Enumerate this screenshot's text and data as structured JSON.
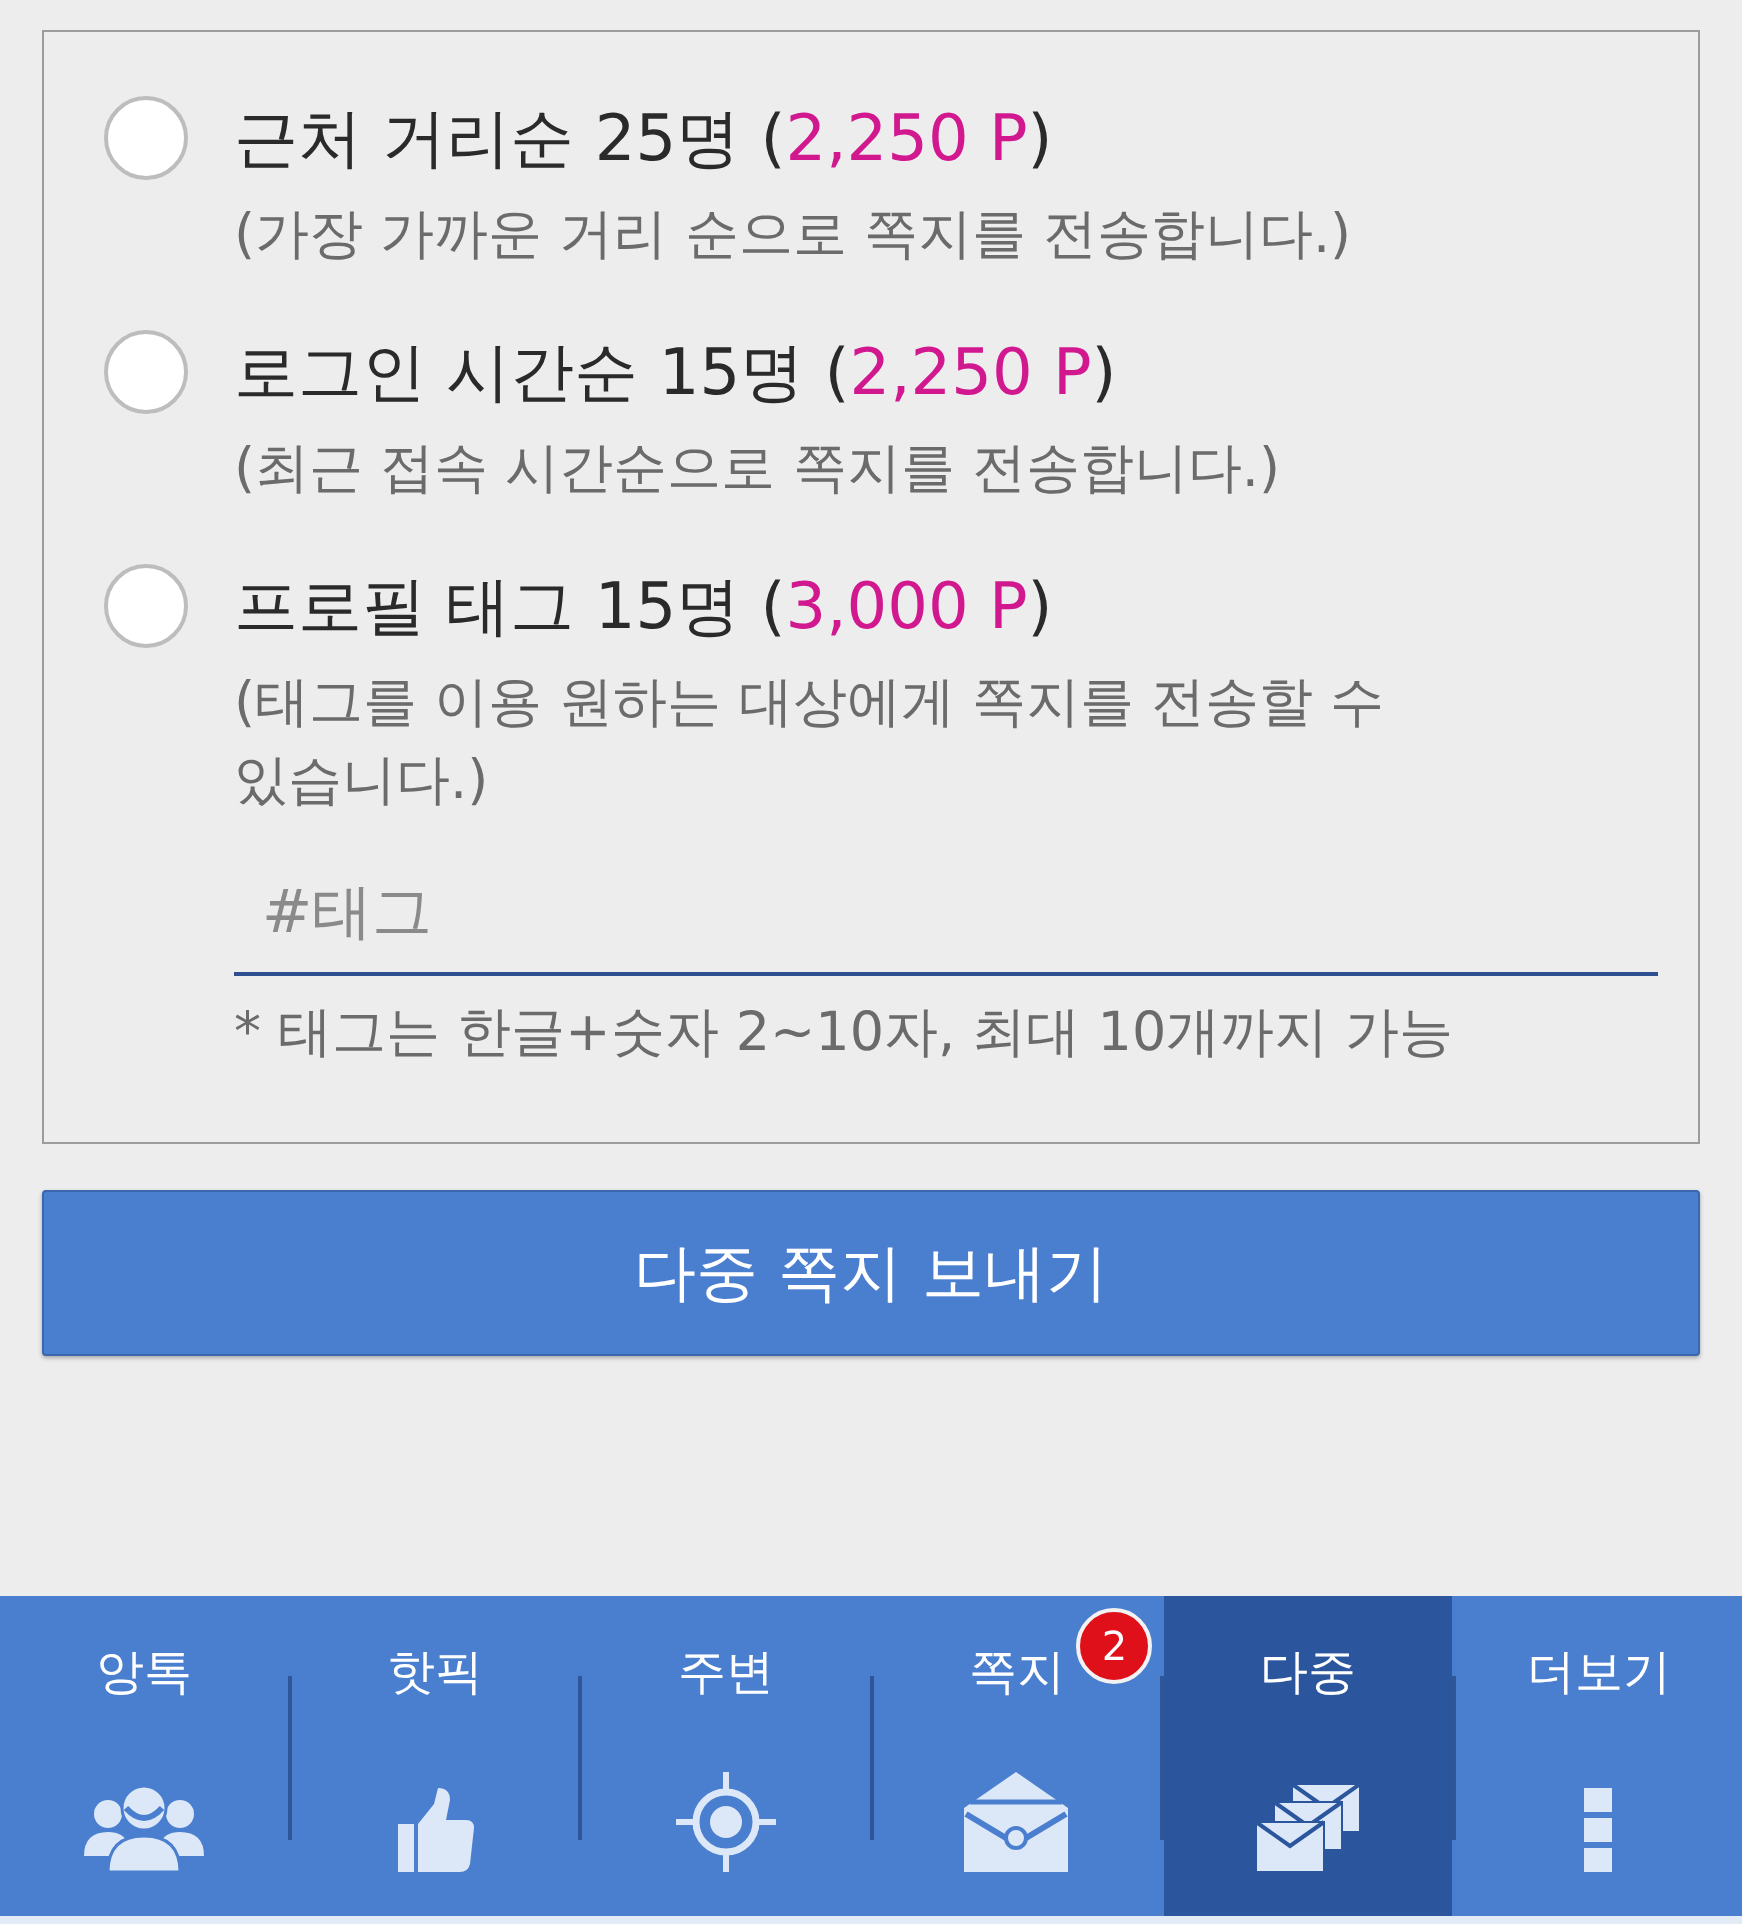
{
  "options": [
    {
      "kind": "plain",
      "selected": false,
      "label": "근처 거리순 25명 (",
      "price": "2,250 P",
      "label_end": ")",
      "description": "(가장 가까운 거리 순으로 쪽지를 전송합니다.)"
    },
    {
      "kind": "plain",
      "selected": false,
      "label": "로그인 시간순 15명 (",
      "price": "2,250 P",
      "label_end": ")",
      "description": "(최근 접속 시간순으로 쪽지를 전송합니다.)"
    },
    {
      "kind": "tag",
      "selected": false,
      "label": "프로필 태그 15명 (",
      "price": "3,000 P",
      "label_end": ")",
      "description": "(태그를 이용 원하는 대상에게 쪽지를 전송할 수 있습니다.)",
      "tag_field": {
        "placeholder": "#태그"
      },
      "hint": "* 태그는 한글+숫자 2~10자, 최대 10개까지 가능"
    }
  ],
  "send_button": "다중 쪽지 보내기",
  "bottom_nav": [
    {
      "label": "앙톡",
      "selected": false
    },
    {
      "label": "핫픽",
      "selected": false
    },
    {
      "label": "주변",
      "selected": false
    },
    {
      "label": "쪽지",
      "selected": false,
      "badge": "2"
    },
    {
      "label": "다중",
      "selected": true
    },
    {
      "label": "더보기",
      "selected": false
    }
  ]
}
